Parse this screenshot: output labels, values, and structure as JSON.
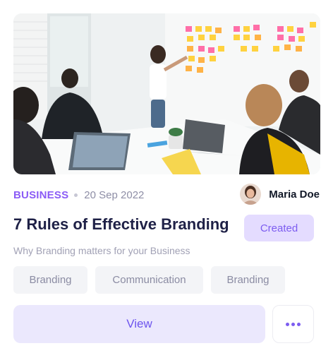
{
  "card": {
    "image_alt": "Team meeting with sticky notes on whiteboard",
    "category": "BUSINESS",
    "date": "20 Sep 2022",
    "author": {
      "name": "Maria Doe"
    },
    "title": "7 Rules of Effective Branding",
    "status": "Created",
    "subtitle": "Why Branding matters for your Business",
    "tags": [
      "Branding",
      "Communication",
      "Branding"
    ],
    "view_label": "View",
    "more_icon": "more-horizontal-icon"
  },
  "colors": {
    "accent": "#8b5cf6",
    "status_bg": "#e4dcff",
    "button_bg": "#ebe8fd",
    "title": "#1f2147"
  }
}
